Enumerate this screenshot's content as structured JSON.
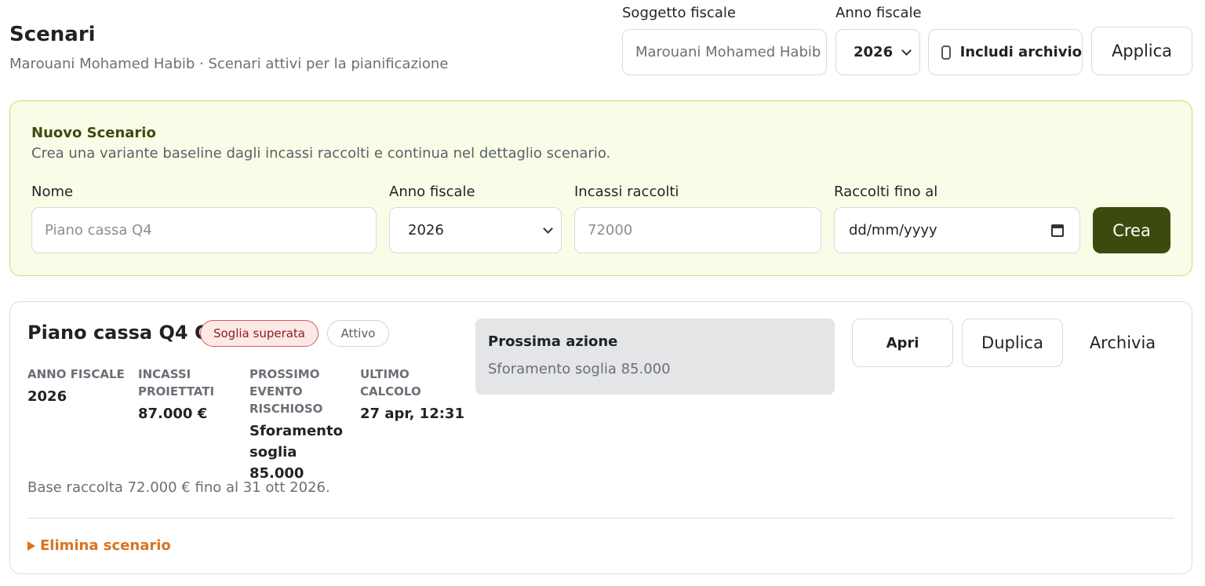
{
  "header": {
    "title": "Scenari",
    "subtitle": "Marouani Mohamed Habib · Scenari attivi per la pianificazione"
  },
  "filters": {
    "subject_label": "Soggetto fiscale",
    "subject_value": "Marouani Mohamed Habib",
    "year_label": "Anno fiscale",
    "year_value": "2026",
    "include_archive_label": "Includi archivio",
    "apply_label": "Applica"
  },
  "new_scenario": {
    "title": "Nuovo Scenario",
    "description": "Crea una variante baseline dagli incassi raccolti e continua nel dettaglio scenario.",
    "name_label": "Nome",
    "name_placeholder": "Piano cassa Q4",
    "year_label": "Anno fiscale",
    "year_value": "2026",
    "income_label": "Incassi raccolti",
    "income_placeholder": "72000",
    "date_label": "Raccolti fino al",
    "date_placeholder": "dd/mm/yyyy",
    "create_label": "Crea"
  },
  "scenario": {
    "title": "Piano cassa Q4 QA",
    "badge_threshold": "Soglia superata",
    "badge_status": "Attivo",
    "stats": [
      {
        "label": "ANNO FISCALE",
        "value": "2026"
      },
      {
        "label": "INCASSI PROIETTATI",
        "value": "87.000 €"
      },
      {
        "label": "PROSSIMO EVENTO RISCHIOSO",
        "value": "Sforamento soglia 85.000"
      },
      {
        "label": "ULTIMO CALCOLO",
        "value": "27 apr, 12:31"
      }
    ],
    "next_action_title": "Prossima azione",
    "next_action_text": "Sforamento soglia 85.000",
    "open_label": "Apri",
    "duplicate_label": "Duplica",
    "archive_label": "Archivia",
    "base_text": "Base raccolta 72.000 € fino al 31 ott 2026.",
    "delete_label": "Elimina scenario"
  }
}
